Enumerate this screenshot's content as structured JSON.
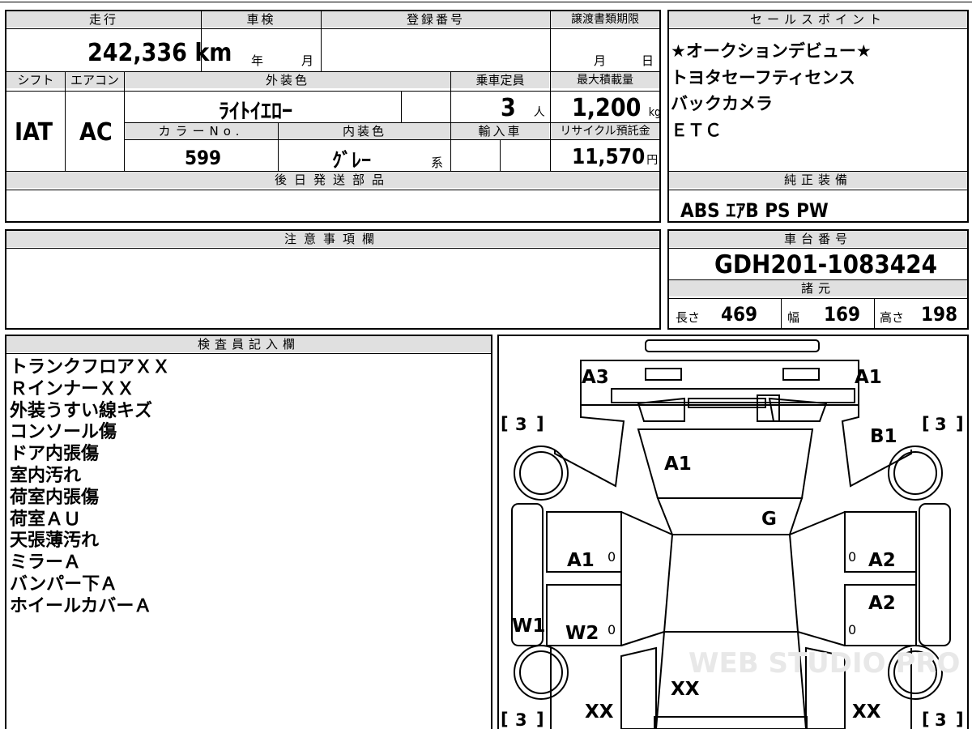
{
  "top": {
    "mileage": {
      "label": "走行",
      "value": "242,336",
      "unit": "km"
    },
    "inspection": {
      "label": "車検",
      "year_unit": "年",
      "month_unit": "月"
    },
    "registration": {
      "label": "登録番号",
      "value": ""
    },
    "transfer_deadline": {
      "label": "譲渡書類期限",
      "month_unit": "月",
      "day_unit": "日"
    },
    "shift": {
      "label": "シフト",
      "value": "IAT"
    },
    "aircon": {
      "label": "エアコン",
      "value": "AC"
    },
    "exterior_color": {
      "label": "外装色",
      "value": "ﾗｲﾄｲｴﾛｰ"
    },
    "capacity": {
      "label": "乗車定員",
      "value": "3",
      "unit": "人"
    },
    "max_load": {
      "label": "最大積載量",
      "value": "1,200",
      "unit": "kg"
    },
    "color_no": {
      "label": "カラーNo.",
      "value": "599"
    },
    "interior_color": {
      "label": "内装色",
      "value": "ｸﾞﾚｰ",
      "suffix": "系"
    },
    "import": {
      "label": "輸入車",
      "value": ""
    },
    "recycle": {
      "label": "リサイクル預託金",
      "value": "11,570",
      "unit": "円"
    },
    "later_parts": {
      "label": "後日発送部品",
      "value": ""
    }
  },
  "sales_points": {
    "label": "セールスポイント",
    "items": [
      "★オークションデビュー★",
      "トヨタセーフティセンス",
      "バックカメラ",
      "ＥＴＣ"
    ]
  },
  "equipment": {
    "label": "純正装備",
    "value": "ABS ｴｱB PS PW"
  },
  "caution": {
    "label": "注意事項欄",
    "value": ""
  },
  "chassis": {
    "label": "車台番号",
    "value": "GDH201-1083424"
  },
  "specs": {
    "label": "諸元",
    "length": {
      "label": "長さ",
      "value": "469"
    },
    "width": {
      "label": "幅",
      "value": "169"
    },
    "height": {
      "label": "高さ",
      "value": "198"
    }
  },
  "inspector": {
    "label": "検査員記入欄",
    "items": [
      "トランクフロアＸＸ",
      "ＲインナーＸＸ",
      "外装うすい線キズ",
      "コンソール傷",
      "ドア内張傷",
      "室内汚れ",
      "荷室内張傷",
      "荷室ＡＵ",
      "天張薄汚れ",
      "ミラーＡ",
      "バンパー下Ａ",
      "ホイールカバーＡ"
    ]
  },
  "diagram": {
    "marks": {
      "a3": "A3",
      "a1_top": "A1",
      "b1": "B1",
      "a1_hood": "A1",
      "g": "G",
      "a1_left": "A1",
      "a2_right": "A2",
      "a2_right2": "A2",
      "w1": "W1",
      "w2": "W2",
      "xx_center": "XX",
      "xx_left": "XX",
      "xx_right": "XX",
      "zero_1": "0",
      "zero_2": "0",
      "zero_3": "0",
      "zero_4": "0"
    },
    "tires": {
      "fl": "3",
      "fr": "3",
      "rl": "3",
      "rr": "3"
    },
    "watermark": "WEB STUDIO PRO"
  }
}
